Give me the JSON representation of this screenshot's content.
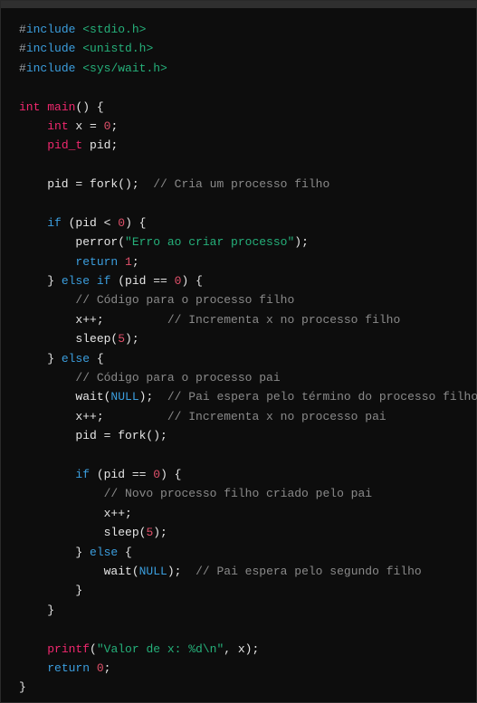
{
  "colors": {
    "background": "#0d0d0d",
    "topbar": "#2f2f2f",
    "keyword": "#3b9ede",
    "type": "#f0286e",
    "number": "#e0506a",
    "string": "#25b07a",
    "comment": "#8a8a8a",
    "plain": "#e6e6e6"
  },
  "code": {
    "lines": [
      [
        {
          "t": "#",
          "c": "hash"
        },
        {
          "t": "include",
          "c": "pp"
        },
        {
          "t": " ",
          "c": "plain"
        },
        {
          "t": "<stdio.h>",
          "c": "hdr"
        }
      ],
      [
        {
          "t": "#",
          "c": "hash"
        },
        {
          "t": "include",
          "c": "pp"
        },
        {
          "t": " ",
          "c": "plain"
        },
        {
          "t": "<unistd.h>",
          "c": "hdr"
        }
      ],
      [
        {
          "t": "#",
          "c": "hash"
        },
        {
          "t": "include",
          "c": "pp"
        },
        {
          "t": " ",
          "c": "plain"
        },
        {
          "t": "<sys/wait.h>",
          "c": "hdr"
        }
      ],
      [],
      [
        {
          "t": "int",
          "c": "type"
        },
        {
          "t": " ",
          "c": "plain"
        },
        {
          "t": "main",
          "c": "type"
        },
        {
          "t": "() {",
          "c": "plain"
        }
      ],
      [
        {
          "t": "    ",
          "c": "plain"
        },
        {
          "t": "int",
          "c": "type"
        },
        {
          "t": " x = ",
          "c": "plain"
        },
        {
          "t": "0",
          "c": "num"
        },
        {
          "t": ";",
          "c": "plain"
        }
      ],
      [
        {
          "t": "    ",
          "c": "plain"
        },
        {
          "t": "pid_t",
          "c": "type"
        },
        {
          "t": " pid;",
          "c": "plain"
        }
      ],
      [],
      [
        {
          "t": "    pid = fork();  ",
          "c": "plain"
        },
        {
          "t": "// Cria um processo filho",
          "c": "com"
        }
      ],
      [],
      [
        {
          "t": "    ",
          "c": "plain"
        },
        {
          "t": "if",
          "c": "kw"
        },
        {
          "t": " (pid < ",
          "c": "plain"
        },
        {
          "t": "0",
          "c": "num"
        },
        {
          "t": ") {",
          "c": "plain"
        }
      ],
      [
        {
          "t": "        perror(",
          "c": "plain"
        },
        {
          "t": "\"Erro ao criar processo\"",
          "c": "str"
        },
        {
          "t": ");",
          "c": "plain"
        }
      ],
      [
        {
          "t": "        ",
          "c": "plain"
        },
        {
          "t": "return",
          "c": "kw"
        },
        {
          "t": " ",
          "c": "plain"
        },
        {
          "t": "1",
          "c": "num"
        },
        {
          "t": ";",
          "c": "plain"
        }
      ],
      [
        {
          "t": "    } ",
          "c": "plain"
        },
        {
          "t": "else",
          "c": "kw"
        },
        {
          "t": " ",
          "c": "plain"
        },
        {
          "t": "if",
          "c": "kw"
        },
        {
          "t": " (pid == ",
          "c": "plain"
        },
        {
          "t": "0",
          "c": "num"
        },
        {
          "t": ") {",
          "c": "plain"
        }
      ],
      [
        {
          "t": "        ",
          "c": "plain"
        },
        {
          "t": "// Código para o processo filho",
          "c": "com"
        }
      ],
      [
        {
          "t": "        x++;         ",
          "c": "plain"
        },
        {
          "t": "// Incrementa x no processo filho",
          "c": "com"
        }
      ],
      [
        {
          "t": "        sleep(",
          "c": "plain"
        },
        {
          "t": "5",
          "c": "num"
        },
        {
          "t": ");",
          "c": "plain"
        }
      ],
      [
        {
          "t": "    } ",
          "c": "plain"
        },
        {
          "t": "else",
          "c": "kw"
        },
        {
          "t": " {",
          "c": "plain"
        }
      ],
      [
        {
          "t": "        ",
          "c": "plain"
        },
        {
          "t": "// Código para o processo pai",
          "c": "com"
        }
      ],
      [
        {
          "t": "        wait(",
          "c": "plain"
        },
        {
          "t": "NULL",
          "c": "const"
        },
        {
          "t": ");  ",
          "c": "plain"
        },
        {
          "t": "// Pai espera pelo término do processo filho",
          "c": "com"
        }
      ],
      [
        {
          "t": "        x++;         ",
          "c": "plain"
        },
        {
          "t": "// Incrementa x no processo pai",
          "c": "com"
        }
      ],
      [
        {
          "t": "        pid = fork();",
          "c": "plain"
        }
      ],
      [],
      [
        {
          "t": "        ",
          "c": "plain"
        },
        {
          "t": "if",
          "c": "kw"
        },
        {
          "t": " (pid == ",
          "c": "plain"
        },
        {
          "t": "0",
          "c": "num"
        },
        {
          "t": ") {",
          "c": "plain"
        }
      ],
      [
        {
          "t": "            ",
          "c": "plain"
        },
        {
          "t": "// Novo processo filho criado pelo pai",
          "c": "com"
        }
      ],
      [
        {
          "t": "            x++;",
          "c": "plain"
        }
      ],
      [
        {
          "t": "            sleep(",
          "c": "plain"
        },
        {
          "t": "5",
          "c": "num"
        },
        {
          "t": ");",
          "c": "plain"
        }
      ],
      [
        {
          "t": "        } ",
          "c": "plain"
        },
        {
          "t": "else",
          "c": "kw"
        },
        {
          "t": " {",
          "c": "plain"
        }
      ],
      [
        {
          "t": "            wait(",
          "c": "plain"
        },
        {
          "t": "NULL",
          "c": "const"
        },
        {
          "t": ");  ",
          "c": "plain"
        },
        {
          "t": "// Pai espera pelo segundo filho",
          "c": "com"
        }
      ],
      [
        {
          "t": "        }",
          "c": "plain"
        }
      ],
      [
        {
          "t": "    }",
          "c": "plain"
        }
      ],
      [],
      [
        {
          "t": "    ",
          "c": "plain"
        },
        {
          "t": "printf",
          "c": "type"
        },
        {
          "t": "(",
          "c": "plain"
        },
        {
          "t": "\"Valor de x: %d\\n\"",
          "c": "str"
        },
        {
          "t": ", x);",
          "c": "plain"
        }
      ],
      [
        {
          "t": "    ",
          "c": "plain"
        },
        {
          "t": "return",
          "c": "kw"
        },
        {
          "t": " ",
          "c": "plain"
        },
        {
          "t": "0",
          "c": "num"
        },
        {
          "t": ";",
          "c": "plain"
        }
      ],
      [
        {
          "t": "}",
          "c": "plain"
        }
      ]
    ]
  }
}
